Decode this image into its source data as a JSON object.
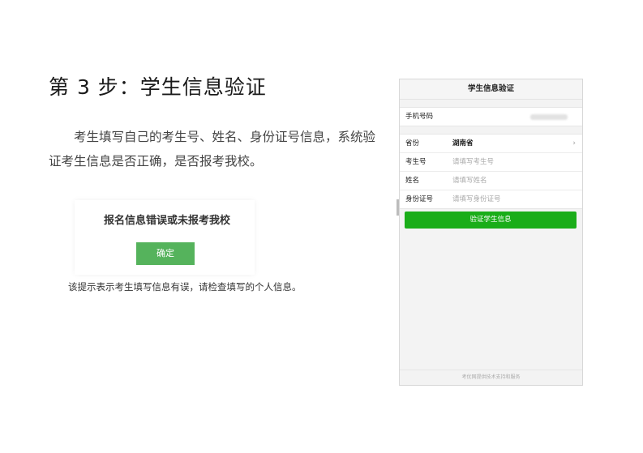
{
  "step": {
    "title": "第 3 步：学生信息验证",
    "description": "考生填写自己的考生号、姓名、身份证号信息，系统验证考生信息是否正确，是否报考我校。"
  },
  "error_dialog": {
    "message": "报名信息错误或未报考我校",
    "confirm_label": "确定"
  },
  "caption": "该提示表示考生填写信息有误，请检查填写的个人信息。",
  "phone": {
    "header_title": "学生信息验证",
    "phone_label": "手机号码",
    "province_label": "省份",
    "province_value": "湖南省",
    "exam_no_label": "考生号",
    "exam_no_placeholder": "请填写考生号",
    "name_label": "姓名",
    "name_placeholder": "请填写姓名",
    "id_label": "身份证号",
    "id_placeholder": "请填写身份证号",
    "verify_label": "验证学生信息",
    "footer": "考优网提供技术支持和服务"
  },
  "colors": {
    "verify_button": "#1aad19",
    "confirm_button": "#55b35c"
  },
  "icons": {
    "province_arrow": "chevron-right-icon"
  }
}
